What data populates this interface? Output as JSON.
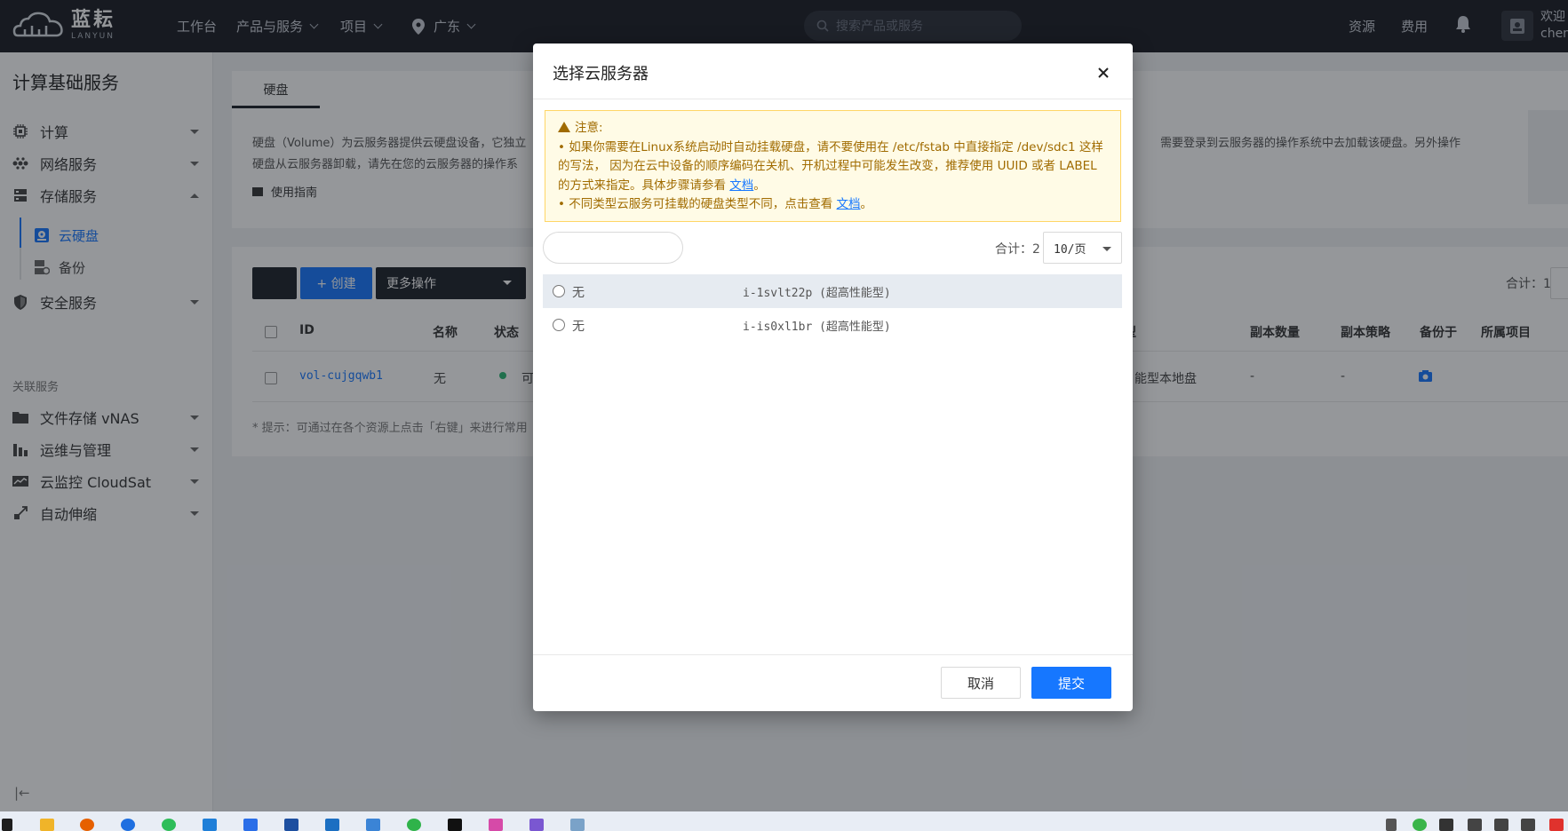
{
  "brand": {
    "name_cn": "蓝耘",
    "name_en": "LANYUN"
  },
  "topnav": {
    "items": [
      "工作台",
      "产品与服务",
      "项目",
      "广东"
    ],
    "search_placeholder": "搜索产品或服务",
    "right": [
      "资源",
      "费用"
    ],
    "user_line1": "欢迎",
    "user_line2": "chen"
  },
  "sidebar": {
    "title": "计算基础服务",
    "items": [
      {
        "label": "计算",
        "icon": "cpu-icon"
      },
      {
        "label": "网络服务",
        "icon": "network-icon"
      },
      {
        "label": "存储服务",
        "icon": "storage-icon"
      }
    ],
    "sub_items": [
      {
        "label": "云硬盘",
        "icon": "disk-icon"
      },
      {
        "label": "备份",
        "icon": "backup-icon"
      }
    ],
    "security": {
      "label": "安全服务",
      "icon": "shield-icon"
    },
    "group_label": "关联服务",
    "related": [
      {
        "label": "文件存储 vNAS",
        "icon": "folder-icon"
      },
      {
        "label": "运维与管理",
        "icon": "ops-icon"
      },
      {
        "label": "云监控 CloudSat",
        "icon": "monitor-icon"
      },
      {
        "label": "自动伸缩",
        "icon": "scale-icon"
      }
    ]
  },
  "main": {
    "tab": "硬盘",
    "intro_line1": "硬盘（Volume）为云服务器提供云硬盘设备，它独立",
    "intro_line1_right": "需要登录到云服务器的操作系统中去加载该硬盘。另外操作",
    "intro_line2": "硬盘从云服务器卸载，请先在您的云服务器的操作系",
    "guide": "使用指南",
    "buttons": {
      "create": "+ 创建",
      "more": "更多操作"
    },
    "total": "合计：1",
    "headers": {
      "id": "ID",
      "name": "名称",
      "status": "状态",
      "type": "型",
      "replicas": "副本数量",
      "policy": "副本策略",
      "backup_at": "备份于",
      "project": "所属项目"
    },
    "row": {
      "id": "vol-cujgqwb1",
      "name": "无",
      "status": "可",
      "type": "能型本地盘",
      "replicas": "-",
      "policy": "-"
    },
    "hint": "* 提示：可通过在各个资源上点击「右键」来进行常用"
  },
  "modal": {
    "title": "选择云服务器",
    "notice_title": "注意:",
    "notice_line1": "• 如果你需要在Linux系统启动时自动挂载硬盘，请不要使用在 /etc/fstab 中直接指定 /dev/sdc1 这样",
    "notice_line2": "的写法， 因为在云中设备的顺序编码在关机、开机过程中可能发生改变，推荐使用 UUID 或者 LABEL",
    "notice_line3": "的方式来指定。具体步骤请参看 ",
    "notice_line4": "• 不同类型云服务可挂载的硬盘类型不同，点击查看 ",
    "doc_link": "文档",
    "period": "。",
    "total": "合计：2",
    "page_size": "10/页",
    "servers": [
      {
        "name": "无",
        "id": "i-1svlt22p (超高性能型)"
      },
      {
        "name": "无",
        "id": "i-is0xl1br (超高性能型)"
      }
    ],
    "cancel": "取消",
    "submit": "提交"
  }
}
